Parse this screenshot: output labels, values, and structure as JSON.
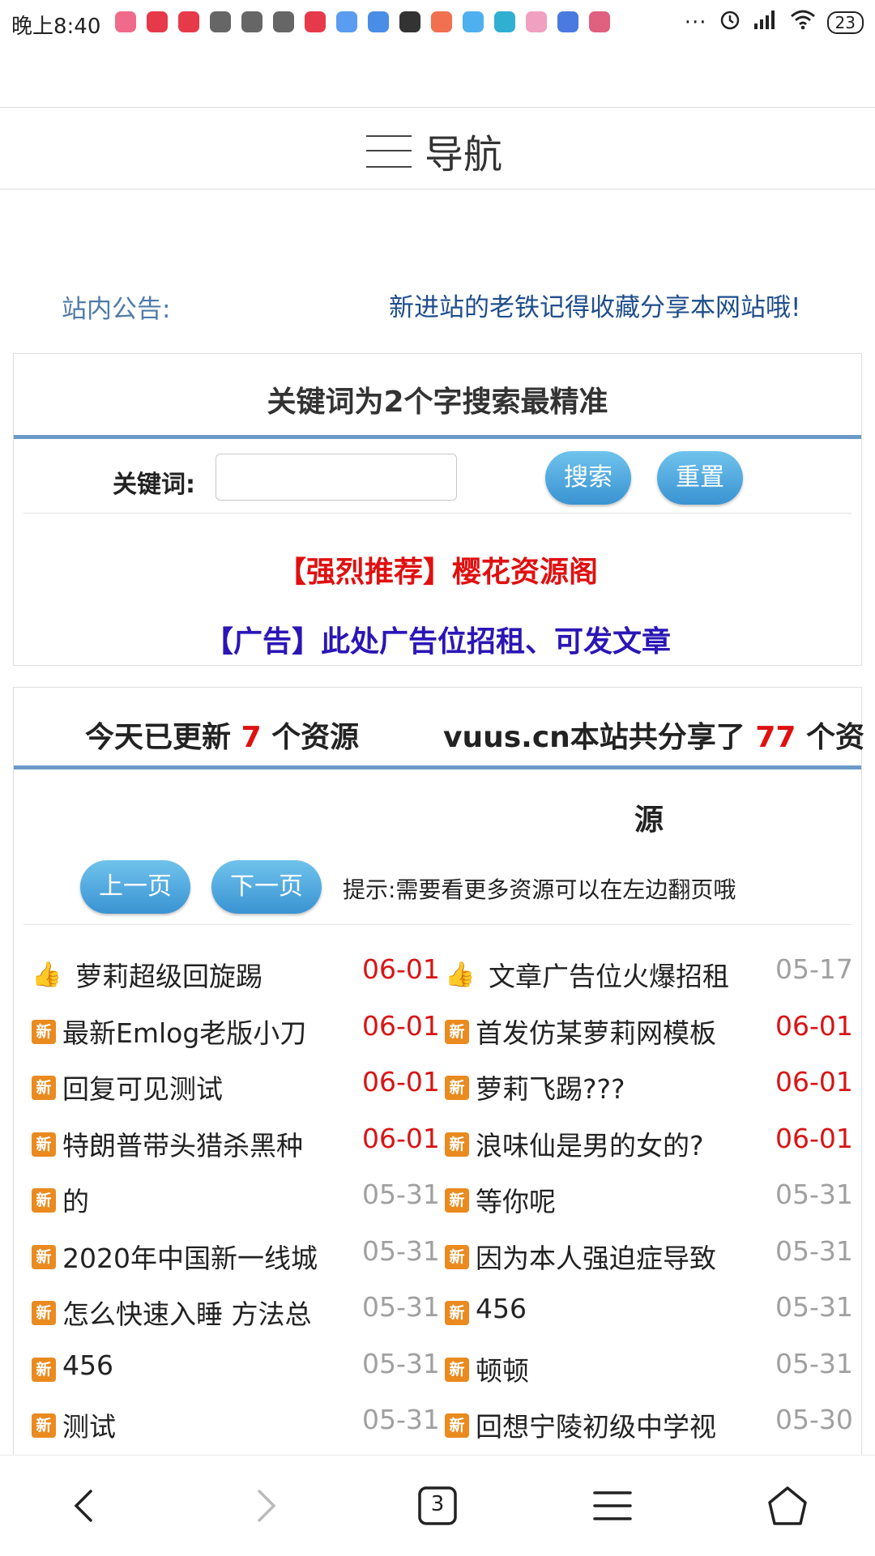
{
  "status_bar": {
    "time": "晚上8:40",
    "overflow": "···",
    "battery": "23",
    "app_icon_colors": [
      "#f06b8b",
      "#e63a4a",
      "#e63a4a",
      "#666666",
      "#666666",
      "#666666",
      "#e63a4a",
      "#5a9cf0",
      "#4a8de6",
      "#333333",
      "#f07050",
      "#4fb0f0",
      "#30b0d0",
      "#f0a0c0",
      "#4a7ae0",
      "#e06080"
    ]
  },
  "nav": {
    "title": "导航"
  },
  "notice": {
    "label": "站内公告:",
    "text": "新进站的老铁记得收藏分享本网站哦!"
  },
  "search": {
    "title": "关键词为2个字搜索最精准",
    "keyword_label": "关键词:",
    "keyword_value": "",
    "search_button": "搜索",
    "reset_button": "重置",
    "promo_recommend": "【强烈推荐】樱花资源阁",
    "promo_ad": "【广告】此处广告位招租、可发文章"
  },
  "stats": {
    "today_prefix": "今天已更新",
    "today_count": "7",
    "today_suffix": "个资源",
    "site_prefix": "vuus.cn本站共分享了",
    "site_count": "77",
    "site_suffix": "个资",
    "site_suffix_wrap": "源"
  },
  "pager": {
    "prev": "上一页",
    "next": "下一页",
    "hint": "提示:需要看更多资源可以在左边翻页哦"
  },
  "resources": [
    {
      "left": {
        "icon": "thumbs-up-icon",
        "title": "萝莉超级回旋踢",
        "date": "06-01",
        "hot": true
      },
      "right": {
        "icon": "thumbs-up-icon",
        "title": "文章广告位火爆招租",
        "date": "05-17",
        "hot": false
      }
    },
    {
      "left": {
        "icon": "new-badge-icon",
        "title": "最新Emlog老版小刀",
        "date": "06-01",
        "hot": true
      },
      "right": {
        "icon": "new-badge-icon",
        "title": "首发仿某萝莉网模板",
        "date": "06-01",
        "hot": true
      }
    },
    {
      "left": {
        "icon": "new-badge-icon",
        "title": "回复可见测试",
        "date": "06-01",
        "hot": true
      },
      "right": {
        "icon": "new-badge-icon",
        "title": "萝莉飞踢???",
        "date": "06-01",
        "hot": true
      }
    },
    {
      "left": {
        "icon": "new-badge-icon",
        "title": "特朗普带头猎杀黑种",
        "date": "06-01",
        "hot": true
      },
      "right": {
        "icon": "new-badge-icon",
        "title": "浪味仙是男的女的?",
        "date": "06-01",
        "hot": true
      }
    },
    {
      "left": {
        "icon": "new-badge-icon",
        "title": "的",
        "date": "05-31",
        "hot": false
      },
      "right": {
        "icon": "new-badge-icon",
        "title": "等你呢",
        "date": "05-31",
        "hot": false
      }
    },
    {
      "left": {
        "icon": "new-badge-icon",
        "title": "2020年中国新一线城",
        "date": "05-31",
        "hot": false
      },
      "right": {
        "icon": "new-badge-icon",
        "title": "因为本人强迫症导致",
        "date": "05-31",
        "hot": false
      }
    },
    {
      "left": {
        "icon": "new-badge-icon",
        "title": "怎么快速入睡 方法总",
        "date": "05-31",
        "hot": false
      },
      "right": {
        "icon": "new-badge-icon",
        "title": "456",
        "date": "05-31",
        "hot": false
      }
    },
    {
      "left": {
        "icon": "new-badge-icon",
        "title": "456",
        "date": "05-31",
        "hot": false
      },
      "right": {
        "icon": "new-badge-icon",
        "title": "顿顿",
        "date": "05-31",
        "hot": false
      }
    },
    {
      "left": {
        "icon": "new-badge-icon",
        "title": "测试",
        "date": "05-31",
        "hot": false
      },
      "right": {
        "icon": "new-badge-icon",
        "title": "回想宁陵初级中学视",
        "date": "05-30",
        "hot": false
      }
    }
  ],
  "new_badge_text": "新",
  "bottom_nav": {
    "tab_count": "3"
  }
}
